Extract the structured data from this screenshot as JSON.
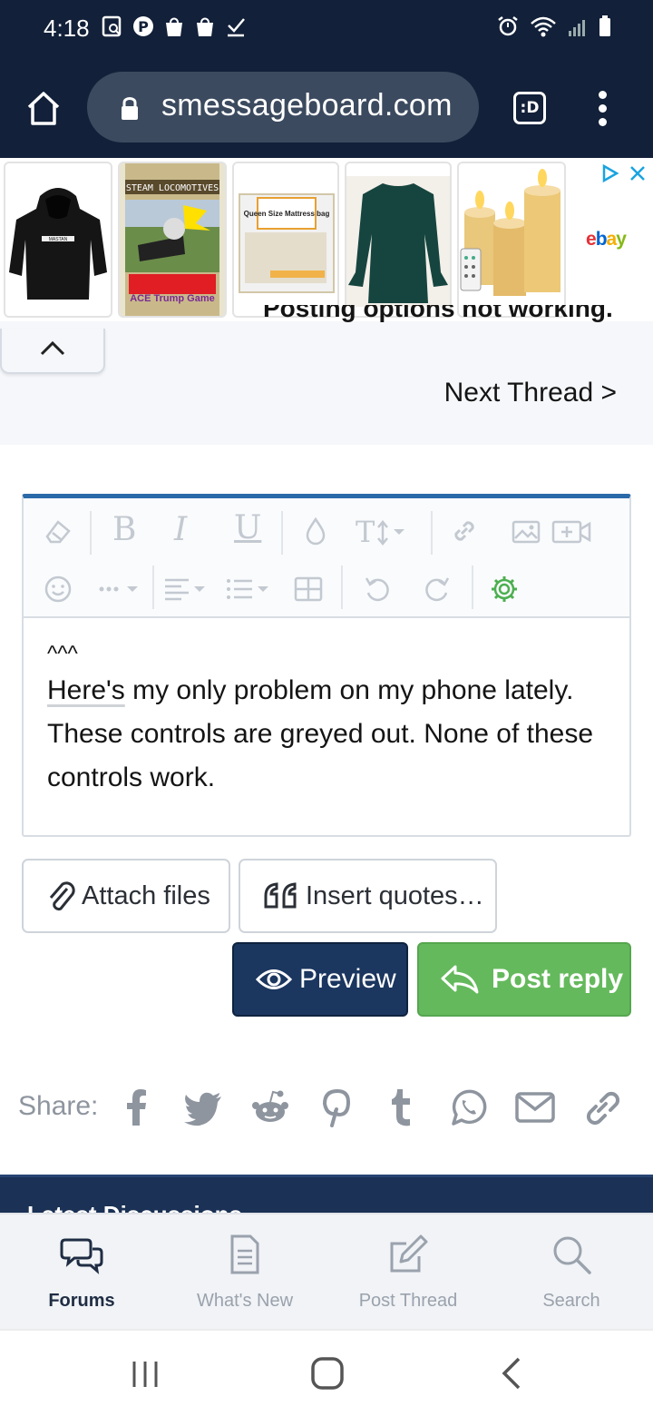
{
  "status_bar": {
    "time": "4:18"
  },
  "browser": {
    "url": "smessageboard.com",
    "tabs_label": ":D"
  },
  "ads": {
    "items": [
      {
        "name": "hoodie",
        "text": "MASTAN"
      },
      {
        "name": "steam-locomotives-game",
        "text": "STEAM LOCOMOTIVES",
        "sub": "ACE Trump Game"
      },
      {
        "name": "mattress-bag",
        "text": "Queen Size Mattress bag"
      },
      {
        "name": "green-blouse"
      },
      {
        "name": "flameless-candles"
      }
    ],
    "store": "ebay"
  },
  "thread_nav": {
    "cut_off_title": "Posting options not working.",
    "next_thread": "Next Thread >"
  },
  "editor": {
    "body_line_1": "^^^",
    "body_here": "Here's",
    "body_rest": " my only problem on my phone lately. These controls are greyed out.  None of these controls work."
  },
  "buttons": {
    "attach_files": "Attach files",
    "insert_quotes": "Insert quotes…",
    "preview": "Preview",
    "post_reply": "Post reply"
  },
  "share": {
    "label": "Share:",
    "targets": [
      "facebook",
      "twitter",
      "reddit",
      "pinterest",
      "tumblr",
      "whatsapp",
      "email",
      "link"
    ]
  },
  "latest_discussions": "Latest Discussions",
  "bottom_nav": [
    {
      "label": "Forums",
      "icon": "chat-bubbles-icon",
      "active": true
    },
    {
      "label": "What's New",
      "icon": "document-icon",
      "active": false
    },
    {
      "label": "Post Thread",
      "icon": "edit-icon",
      "active": false
    },
    {
      "label": "Search",
      "icon": "search-icon",
      "active": false
    }
  ],
  "colors": {
    "chrome_bg": "#122039",
    "editor_accent": "#2b6aa9",
    "preview_bg": "#1b365f",
    "post_reply_bg": "#64b95c",
    "settings_gear": "#4caf50"
  }
}
